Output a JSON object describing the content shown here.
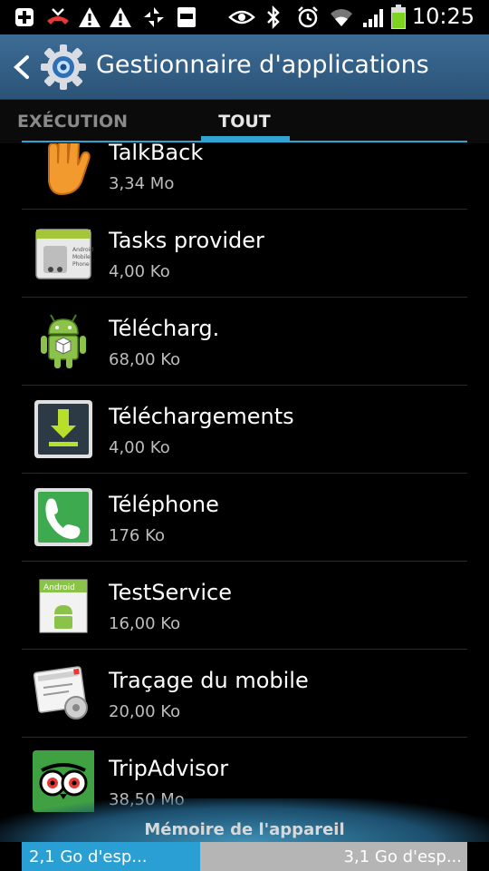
{
  "status_bar": {
    "time": "10:25",
    "battery_level": 0.85,
    "icons": [
      "add-icon",
      "missed-call-icon",
      "warning-icon",
      "warning-icon",
      "sync-icon",
      "galaxy-icon",
      "eye-icon",
      "bluetooth-icon",
      "alarm-icon",
      "wifi-icon",
      "signal-icon",
      "battery-icon"
    ]
  },
  "action_bar": {
    "title": "Gestionnaire d'applications"
  },
  "tabs": [
    {
      "label": "EXÉCUTION",
      "selected": false
    },
    {
      "label": "TOUT",
      "selected": true
    }
  ],
  "apps": [
    {
      "name": "TalkBack",
      "size": "3,34 Mo",
      "icon": "hand-icon"
    },
    {
      "name": "Tasks provider",
      "size": "4,00 Ko",
      "icon": "android-system-icon"
    },
    {
      "name": "Télécharg.",
      "size": "68,00 Ko",
      "icon": "android-package-icon"
    },
    {
      "name": "Téléchargements",
      "size": "4,00 Ko",
      "icon": "download-icon"
    },
    {
      "name": "Téléphone",
      "size": "176 Ko",
      "icon": "phone-icon"
    },
    {
      "name": "TestService",
      "size": "16,00 Ko",
      "icon": "android-test-icon"
    },
    {
      "name": "Traçage du mobile",
      "size": "20,00 Ko",
      "icon": "tracking-icon"
    },
    {
      "name": "TripAdvisor",
      "size": "38,50 Mo",
      "icon": "tripadvisor-icon"
    }
  ],
  "storage": {
    "title": "Mémoire de l'appareil",
    "used_label": "2,1 Go d'esp...",
    "free_label": "3,1 Go d'esp...",
    "used_fraction": 0.4
  },
  "colors": {
    "accent": "#2fa3d2",
    "action_bar": "#33607f",
    "storage_used": "#2a9fd4",
    "storage_free": "#b5b5b5"
  }
}
